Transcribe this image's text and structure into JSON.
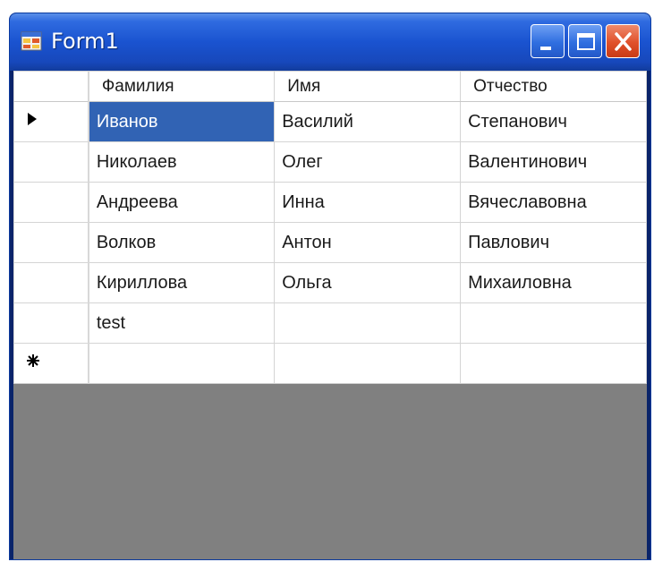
{
  "window": {
    "title": "Form1"
  },
  "grid": {
    "columns": [
      "Фамилия",
      "Имя",
      "Отчество"
    ],
    "rows": [
      [
        "Иванов",
        "Василий",
        "Степанович"
      ],
      [
        "Николаев",
        "Олег",
        "Валентинович"
      ],
      [
        "Андреева",
        "Инна",
        "Вячеславовна"
      ],
      [
        "Волков",
        "Антон",
        "Павлович"
      ],
      [
        "Кириллова",
        "Ольга",
        "Михаиловна"
      ],
      [
        "test",
        "",
        ""
      ],
      [
        "",
        "",
        ""
      ]
    ],
    "current_row_marker": "▶",
    "new_row_marker": "✱",
    "selected_cell": "Иванов",
    "selected_color": "#3163b4"
  },
  "icons": {
    "app": "form-app-icon",
    "minimize": "minimize-icon",
    "maximize": "maximize-icon",
    "close": "close-icon"
  }
}
